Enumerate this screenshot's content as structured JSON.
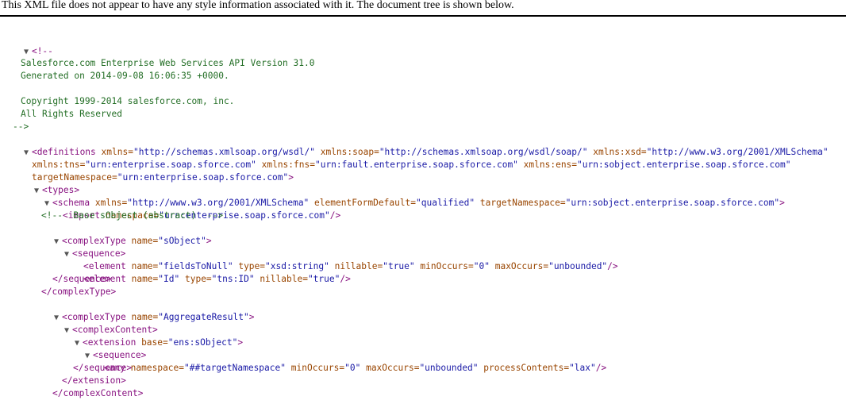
{
  "header": "This XML file does not appear to have any style information associated with it. The document tree is shown below.",
  "comment": {
    "open": "<!--",
    "lines": [
      "Salesforce.com Enterprise Web Services API Version 31.0",
      "Generated on 2014-09-08 16:06:35 +0000.",
      "Copyright 1999-2014 salesforce.com, inc.",
      "All Rights Reserved"
    ],
    "close": "-->"
  },
  "xml": {
    "definitions": {
      "open": "<definitions",
      "a1": "xmlns=",
      "v1": "\"http://schemas.xmlsoap.org/wsdl/\"",
      "a2": "xmlns:soap=",
      "v2": "\"http://schemas.xmlsoap.org/wsdl/soap/\"",
      "a3": "xmlns:xsd=",
      "v3": "\"http://www.w3.org/2001/XMLSchema\"",
      "a4": "xmlns:tns=",
      "v4": "\"urn:enterprise.soap.sforce.com\"",
      "a5": "xmlns:fns=",
      "v5": "\"urn:fault.enterprise.soap.sforce.com\"",
      "a6": "xmlns:ens=",
      "v6": "\"urn:sobject.enterprise.soap.sforce.com\"",
      "a7": "targetNamespace=",
      "v7": "\"urn:enterprise.soap.sforce.com\"",
      "end": ">"
    },
    "types_open": "<types>",
    "schema": {
      "open": "<schema",
      "a1": "xmlns=",
      "v1": "\"http://www.w3.org/2001/XMLSchema\"",
      "a2": "elementFormDefault=",
      "v2": "\"qualified\"",
      "a3": "targetNamespace=",
      "v3": "\"urn:sobject.enterprise.soap.sforce.com\"",
      "end": ">"
    },
    "import": {
      "open": "<import",
      "a1": "namespace=",
      "v1": "\"urn:enterprise.soap.sforce.com\"",
      "end": "/>"
    },
    "base_comment": "<!--  Base sObject (abstract)  -->",
    "ct1": {
      "open": "<complexType",
      "a1": "name=",
      "v1": "\"sObject\"",
      "end": ">"
    },
    "seq_open": "<sequence>",
    "el1": {
      "open": "<element",
      "a1": "name=",
      "v1": "\"fieldsToNull\"",
      "a2": "type=",
      "v2": "\"xsd:string\"",
      "a3": "nillable=",
      "v3": "\"true\"",
      "a4": "minOccurs=",
      "v4": "\"0\"",
      "a5": "maxOccurs=",
      "v5": "\"unbounded\"",
      "end": "/>"
    },
    "el2": {
      "open": "<element",
      "a1": "name=",
      "v1": "\"Id\"",
      "a2": "type=",
      "v2": "\"tns:ID\"",
      "a3": "nillable=",
      "v3": "\"true\"",
      "end": "/>"
    },
    "seq_close": "</sequence>",
    "ct_close": "</complexType>",
    "ct2": {
      "open": "<complexType",
      "a1": "name=",
      "v1": "\"AggregateResult\"",
      "end": ">"
    },
    "cc_open": "<complexContent>",
    "ext": {
      "open": "<extension",
      "a1": "base=",
      "v1": "\"ens:sObject\"",
      "end": ">"
    },
    "any": {
      "open": "<any",
      "a1": "namespace=",
      "v1": "\"##targetNamespace\"",
      "a2": "minOccurs=",
      "v2": "\"0\"",
      "a3": "maxOccurs=",
      "v3": "\"unbounded\"",
      "a4": "processContents=",
      "v4": "\"lax\"",
      "end": "/>"
    },
    "ext_close": "</extension>",
    "cc_close": "</complexContent>"
  },
  "toggle_icon": "▼"
}
